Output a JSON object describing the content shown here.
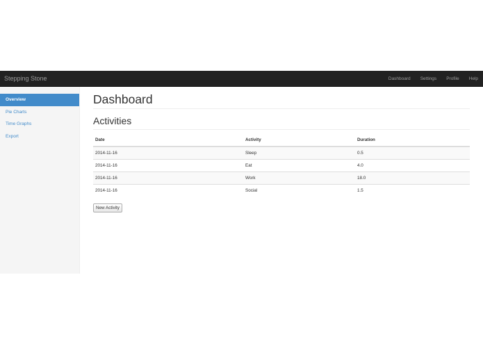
{
  "navbar": {
    "brand": "Stepping Stone",
    "links": [
      "Dashboard",
      "Settings",
      "Profile",
      "Help"
    ]
  },
  "sidebar": {
    "items": [
      {
        "label": "Overview",
        "active": true
      },
      {
        "label": "Pie Charts",
        "active": false
      },
      {
        "label": "Time Graphs",
        "active": false
      },
      {
        "label": "Export",
        "active": false
      }
    ]
  },
  "main": {
    "title": "Dashboard",
    "section_title": "Activities",
    "table": {
      "headers": [
        "Date",
        "Activity",
        "Duration"
      ],
      "rows": [
        [
          "2014-11-16",
          "Sleep",
          "0.5"
        ],
        [
          "2014-11-16",
          "Eat",
          "4.0"
        ],
        [
          "2014-11-16",
          "Work",
          "18.0"
        ],
        [
          "2014-11-16",
          "Social",
          "1.5"
        ]
      ]
    },
    "new_button": "New Activity"
  },
  "colors": {
    "navbar_bg": "#222222",
    "nav_text": "#9d9d9d",
    "accent": "#428bca",
    "sidebar_bg": "#f5f5f5"
  }
}
